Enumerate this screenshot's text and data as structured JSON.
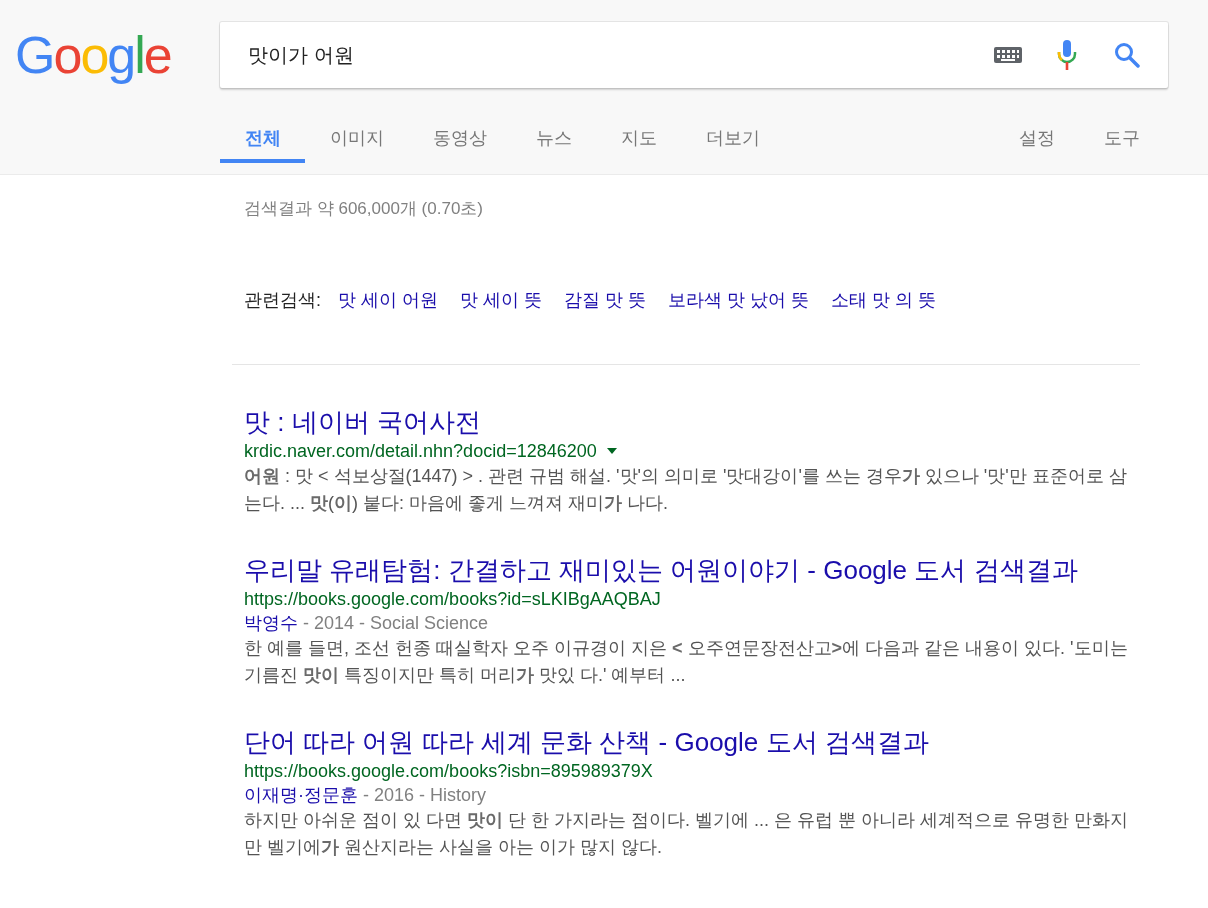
{
  "logo": "Google",
  "search": {
    "value": "맛이가 어원"
  },
  "tabs": [
    {
      "label": "전체",
      "selected": true
    },
    {
      "label": "이미지",
      "selected": false
    },
    {
      "label": "동영상",
      "selected": false
    },
    {
      "label": "뉴스",
      "selected": false
    },
    {
      "label": "지도",
      "selected": false
    },
    {
      "label": "더보기",
      "selected": false
    }
  ],
  "tools": [
    "설정",
    "도구"
  ],
  "result_stats": "검색결과 약 606,000개 (0.70초)",
  "related": {
    "label": "관련검색:",
    "items": [
      "맛 세이 어원",
      "맛 세이 뜻",
      "감질 맛 뜻",
      "보라색 맛 났어 뜻",
      "소태 맛 의 뜻"
    ]
  },
  "results": [
    {
      "title": "맛 : 네이버 국어사전",
      "url": "krdic.naver.com/detail.nhn?docid=12846200",
      "has_menu": true,
      "snippet": "**어원** : 맛 < 석보상절(1447) > . 관련 규범 해설. '맛'의 의미로 '맛대강이'를 쓰는 경우**가** 있으나 '맛'만 표준어로 삼는다. ... **맛**(**이**) 붙다: 마음에 좋게 느껴져 재미**가** 나다."
    },
    {
      "title": "우리말 유래탐험: 간결하고 재미있는 어원이야기 - Google 도서 검색결과",
      "url": "https://books.google.com/books?id=sLKIBgAAQBAJ",
      "has_menu": false,
      "author": "박영수",
      "meta": " - 2014 - Social Science",
      "snippet": "한 예를 들면, 조선 헌종 때실학자 오주 이규경이 지은 **<** 오주연문장전산고**>**에 다음과 같은 내용이 있다. '도미는 기름진 **맛이** 특징이지만 특히 머리**가** 맛있 다.' 예부터 ..."
    },
    {
      "title": "단어 따라 어원 따라 세계 문화 산책 - Google 도서 검색결과",
      "url": "https://books.google.com/books?isbn=895989379X",
      "has_menu": false,
      "author": "이재명·정문훈",
      "meta": " - 2016 - History",
      "snippet": "하지만 아쉬운 점이 있 다면 **맛이** 단 한 가지라는 점이다. 벨기에 ... 은 유럽 뿐 아니라 세계적으로 유명한 만화지만 벨기에**가** 원산지라는 사실을 아는 이가 많지 않다."
    }
  ]
}
